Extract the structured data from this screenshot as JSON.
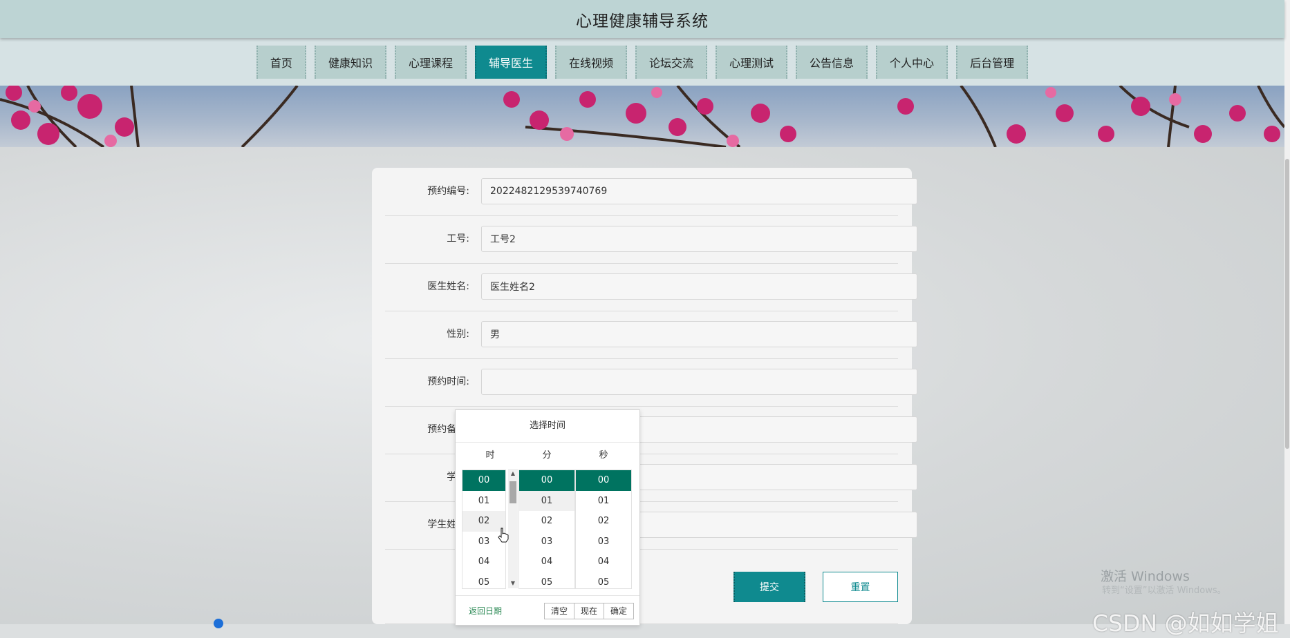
{
  "header": {
    "title": "心理健康辅导系统"
  },
  "nav": {
    "items": [
      {
        "label": "首页"
      },
      {
        "label": "健康知识"
      },
      {
        "label": "心理课程"
      },
      {
        "label": "辅导医生",
        "active": true
      },
      {
        "label": "在线视频"
      },
      {
        "label": "论坛交流"
      },
      {
        "label": "心理测试"
      },
      {
        "label": "公告信息"
      },
      {
        "label": "个人中心"
      },
      {
        "label": "后台管理"
      }
    ]
  },
  "form": {
    "fields": [
      {
        "label": "预约编号:",
        "value": "2022482129539740769"
      },
      {
        "label": "工号:",
        "value": "工号2"
      },
      {
        "label": "医生姓名:",
        "value": "医生姓名2"
      },
      {
        "label": "性别:",
        "value": "男"
      },
      {
        "label": "预约时间:",
        "value": ""
      },
      {
        "label": "预约备注:",
        "value": ""
      },
      {
        "label": "学号:",
        "value": ""
      },
      {
        "label": "学生姓名:",
        "value": ""
      }
    ],
    "submit_label": "提交",
    "reset_label": "重置"
  },
  "time_picker": {
    "title": "选择时间",
    "col_headers": [
      "时",
      "分",
      "秒"
    ],
    "options": [
      "00",
      "01",
      "02",
      "03",
      "04",
      "05"
    ],
    "selected": {
      "hour": "00",
      "minute": "00",
      "second": "00"
    },
    "back_label": "返回日期",
    "clear_label": "清空",
    "now_label": "现在",
    "confirm_label": "确定"
  },
  "watermark": {
    "activate_title": "激活 Windows",
    "activate_sub": "转到“设置”以激活 Windows。",
    "csdn": "CSDN @如如学姐"
  },
  "colors": {
    "accent": "#0f8a8f",
    "picker_selected": "#007360",
    "header_bg": "#bdd4d4"
  }
}
